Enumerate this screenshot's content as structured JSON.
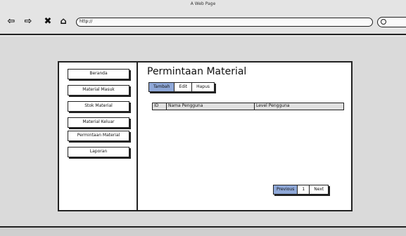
{
  "window": {
    "title": "A Web Page"
  },
  "browser": {
    "url": "http://",
    "nav_icons": [
      "back-arrow-icon",
      "forward-arrow-icon",
      "close-icon",
      "home-icon"
    ]
  },
  "sidebar": {
    "items": [
      {
        "label": "Beranda"
      },
      {
        "label": "Material Masuk"
      },
      {
        "label": "Stok Material"
      },
      {
        "label": "Material Keluar"
      },
      {
        "label": "Permintaan Material"
      },
      {
        "label": "Laporan"
      }
    ]
  },
  "main": {
    "title": "Permintaan Material",
    "tabs": [
      {
        "label": "Tambah",
        "active": true
      },
      {
        "label": "Edit",
        "active": false
      },
      {
        "label": "Hapus",
        "active": false
      }
    ],
    "table": {
      "columns": [
        "ID",
        "Nama Pengguna",
        "Level Pengguna"
      ],
      "rows": []
    },
    "pagination": {
      "previous": "Previous",
      "page": "1",
      "next": "Next"
    }
  },
  "colors": {
    "accent": "#8fa8d8",
    "ink": "#222222"
  }
}
